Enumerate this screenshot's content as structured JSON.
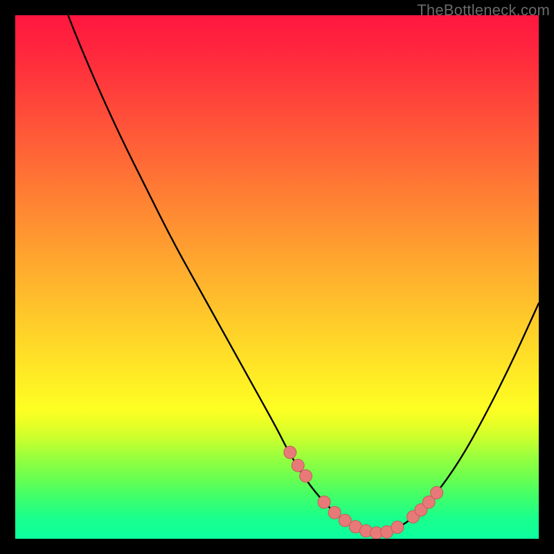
{
  "watermark": "TheBottleneck.com",
  "colors": {
    "background": "#000000",
    "curve_stroke": "#000000",
    "marker_fill": "#e77a78",
    "marker_stroke": "#c65a58"
  },
  "chart_data": {
    "type": "line",
    "title": "",
    "xlabel": "",
    "ylabel": "",
    "xlim": [
      0,
      100
    ],
    "ylim": [
      0,
      100
    ],
    "grid": false,
    "legend": false,
    "note": "Bottleneck percentage curve. x = relative hardware balance position; y = bottleneck % (higher = worse). Values estimated from pixel positions; no axis ticks or numeric labels are rendered in the image.",
    "series": [
      {
        "name": "bottleneck-curve",
        "x": [
          0,
          5,
          10,
          15,
          20,
          25,
          30,
          35,
          40,
          45,
          50,
          52,
          55,
          58,
          62,
          65,
          68,
          70,
          73,
          76,
          80,
          85,
          90,
          95,
          100
        ],
        "y": [
          133,
          114,
          100,
          88,
          77,
          67,
          57,
          48,
          39,
          30,
          21,
          17,
          12,
          8,
          4,
          2,
          1,
          1,
          2,
          4,
          8,
          15,
          24,
          34,
          45
        ]
      }
    ],
    "markers": {
      "name": "highlighted-points",
      "x": [
        52.5,
        54.0,
        55.5,
        59.0,
        61.0,
        63.0,
        65.0,
        67.0,
        69.0,
        71.0,
        73.0,
        76.0,
        77.5,
        79.0,
        80.5
      ],
      "y": [
        16.5,
        14.0,
        12.0,
        7.0,
        5.0,
        3.5,
        2.3,
        1.5,
        1.1,
        1.3,
        2.2,
        4.2,
        5.5,
        7.0,
        8.8
      ]
    }
  }
}
